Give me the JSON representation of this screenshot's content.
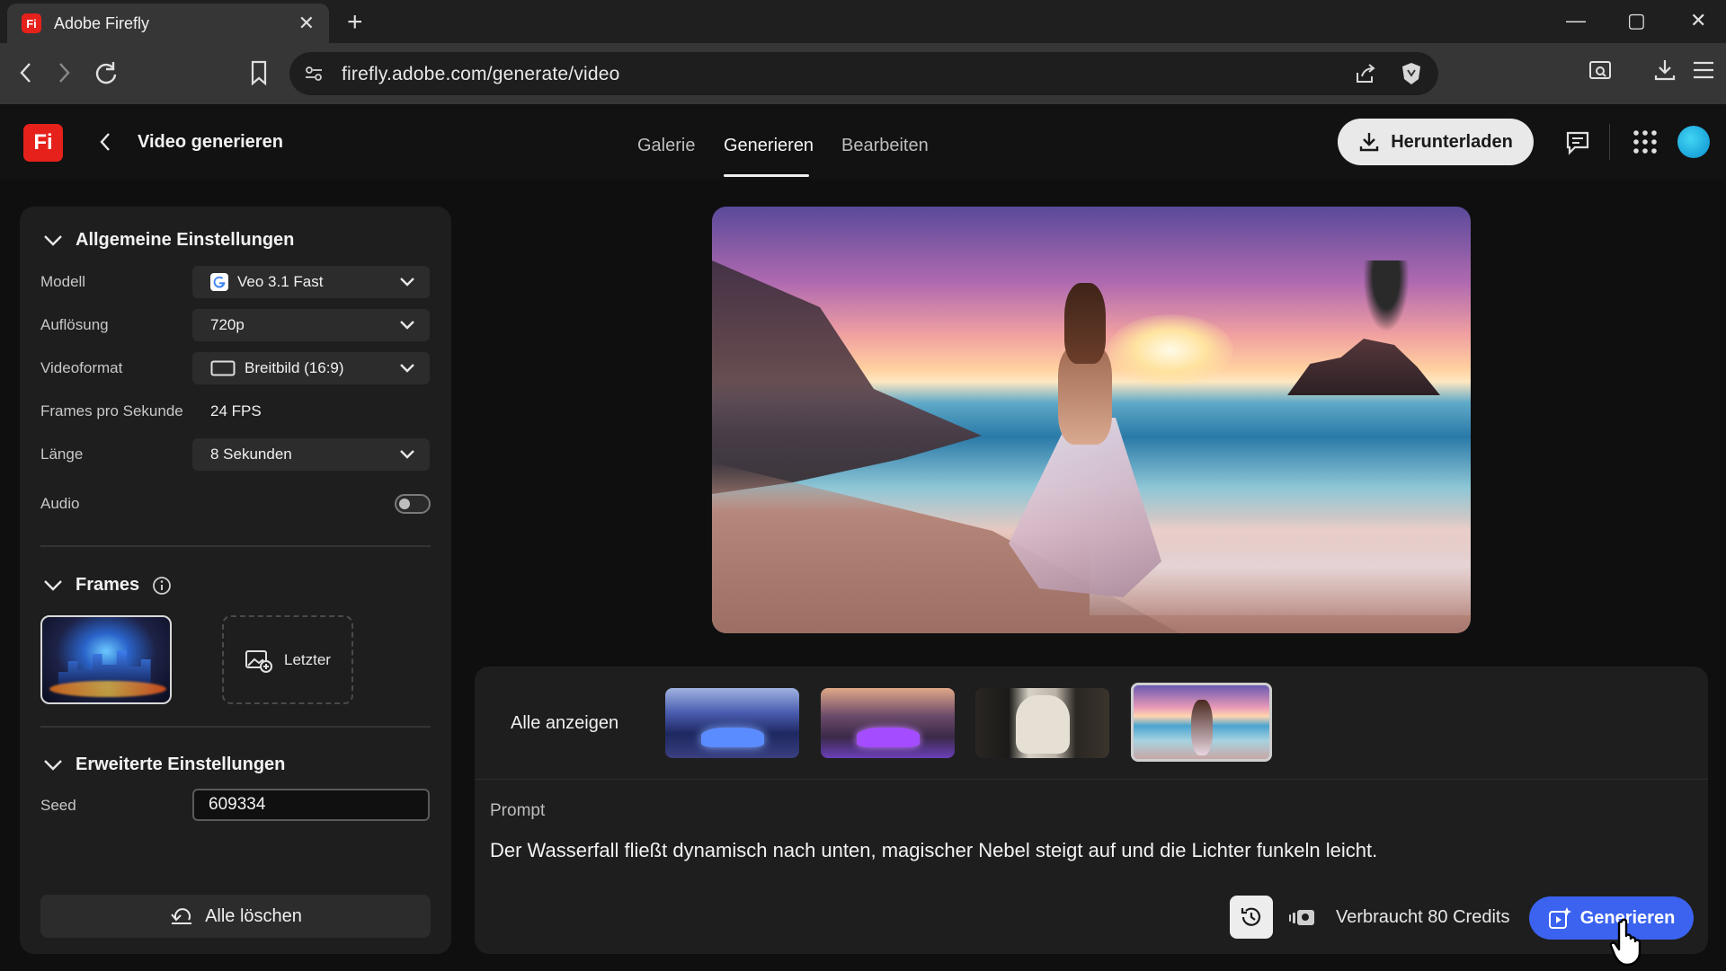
{
  "browser": {
    "tab_title": "Adobe Firefly",
    "tab_favicon": "Fi",
    "url": "firefly.adobe.com/generate/video"
  },
  "app": {
    "logo": "Fi",
    "page_title": "Video generieren",
    "nav": [
      "Galerie",
      "Generieren",
      "Bearbeiten"
    ],
    "active_nav": "Generieren",
    "download_label": "Herunterladen",
    "accent_color": "#3b63f0",
    "brand_color": "#e6211b"
  },
  "settings": {
    "general_title": "Allgemeine Einstellungen",
    "model_label": "Modell",
    "model_value": "Veo 3.1 Fast",
    "resolution_label": "Auflösung",
    "resolution_value": "720p",
    "format_label": "Videoformat",
    "format_value": "Breitbild (16:9)",
    "fps_label": "Frames pro Sekunde",
    "fps_value": "24 FPS",
    "length_label": "Länge",
    "length_value": "8 Sekunden",
    "audio_label": "Audio",
    "audio_on": false,
    "frames_title": "Frames",
    "last_frame_label": "Letzter",
    "advanced_title": "Erweiterte Einstellungen",
    "seed_label": "Seed",
    "seed_value": "609334",
    "clear_label": "Alle löschen"
  },
  "results": {
    "show_all_label": "Alle anzeigen",
    "selected_thumbnail": 4,
    "prompt_label": "Prompt",
    "prompt_text": "Der Wasserfall fließt dynamisch nach unten, magischer Nebel steigt auf und die Lichter funkeln leicht.",
    "credits_text": "Verbraucht 80 Credits",
    "generate_label": "Generieren"
  }
}
